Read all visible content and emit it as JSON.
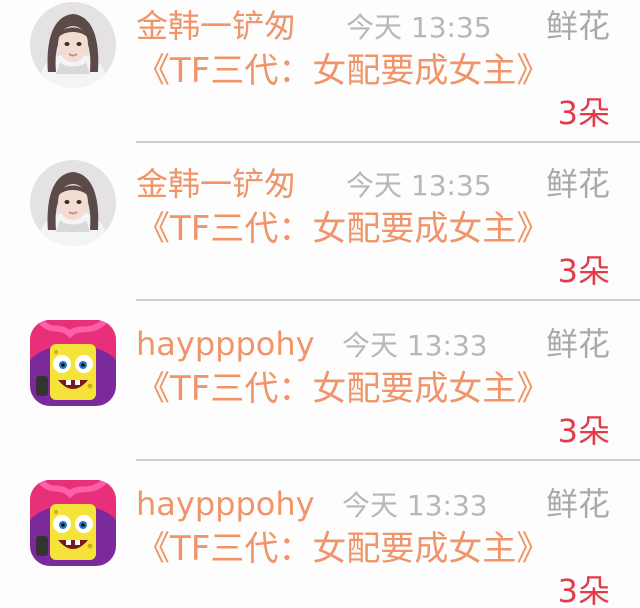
{
  "gifts": [
    {
      "user": "金韩一铲匆",
      "time": "今天 13:35",
      "gift_name": "鲜花",
      "book_title": "《TF三代：女配要成女主》",
      "count": "3朵",
      "avatar": "girl-avatar"
    },
    {
      "user": "金韩一铲匆",
      "time": "今天 13:35",
      "gift_name": "鲜花",
      "book_title": "《TF三代：女配要成女主》",
      "count": "3朵",
      "avatar": "girl-avatar"
    },
    {
      "user": "haypppohy",
      "time": "今天 13:33",
      "gift_name": "鲜花",
      "book_title": "《TF三代：女配要成女主》",
      "count": "3朵",
      "avatar": "spongebob-avatar"
    },
    {
      "user": "haypppohy",
      "time": "今天 13:33",
      "gift_name": "鲜花",
      "book_title": "《TF三代：女配要成女主》",
      "count": "3朵",
      "avatar": "spongebob-avatar"
    }
  ],
  "colors": {
    "username": "#f0956a",
    "time": "#b7b7b7",
    "gift_label": "#a9a9a9",
    "count": "#e23c4a"
  }
}
